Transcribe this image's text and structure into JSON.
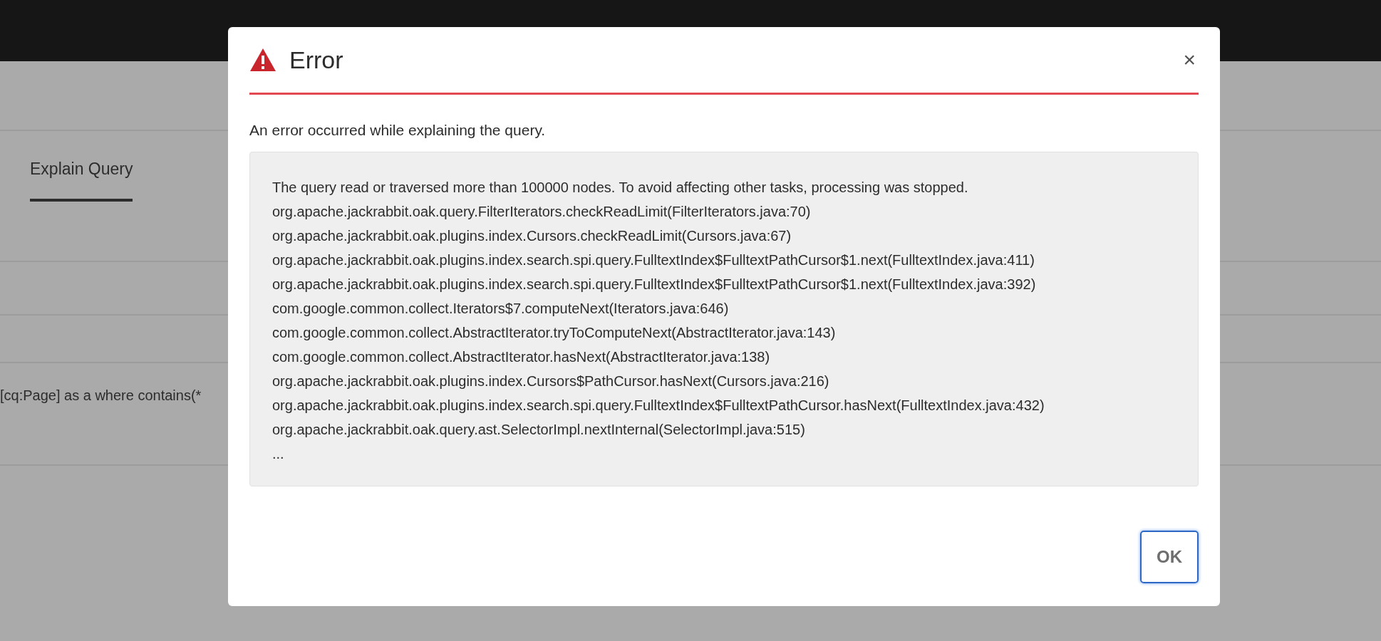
{
  "background": {
    "tab": {
      "label": "Explain Query",
      "selected": true
    },
    "query_text": "[cq:Page] as a where contains(*"
  },
  "dialog": {
    "title": "Error",
    "message": "An error occurred while explaining the query.",
    "details": [
      "The query read or traversed more than 100000 nodes. To avoid affecting other tasks, processing was stopped.",
      "org.apache.jackrabbit.oak.query.FilterIterators.checkReadLimit(FilterIterators.java:70)",
      "org.apache.jackrabbit.oak.plugins.index.Cursors.checkReadLimit(Cursors.java:67)",
      "org.apache.jackrabbit.oak.plugins.index.search.spi.query.FulltextIndex$FulltextPathCursor$1.next(FulltextIndex.java:411)",
      "org.apache.jackrabbit.oak.plugins.index.search.spi.query.FulltextIndex$FulltextPathCursor$1.next(FulltextIndex.java:392)",
      "com.google.common.collect.Iterators$7.computeNext(Iterators.java:646)",
      "com.google.common.collect.AbstractIterator.tryToComputeNext(AbstractIterator.java:143)",
      "com.google.common.collect.AbstractIterator.hasNext(AbstractIterator.java:138)",
      "org.apache.jackrabbit.oak.plugins.index.Cursors$PathCursor.hasNext(Cursors.java:216)",
      "org.apache.jackrabbit.oak.plugins.index.search.spi.query.FulltextIndex$FulltextPathCursor.hasNext(FulltextIndex.java:432)",
      "org.apache.jackrabbit.oak.query.ast.SelectorImpl.nextInternal(SelectorImpl.java:515)",
      "..."
    ],
    "close": "×",
    "buttons": [
      "OK"
    ]
  }
}
